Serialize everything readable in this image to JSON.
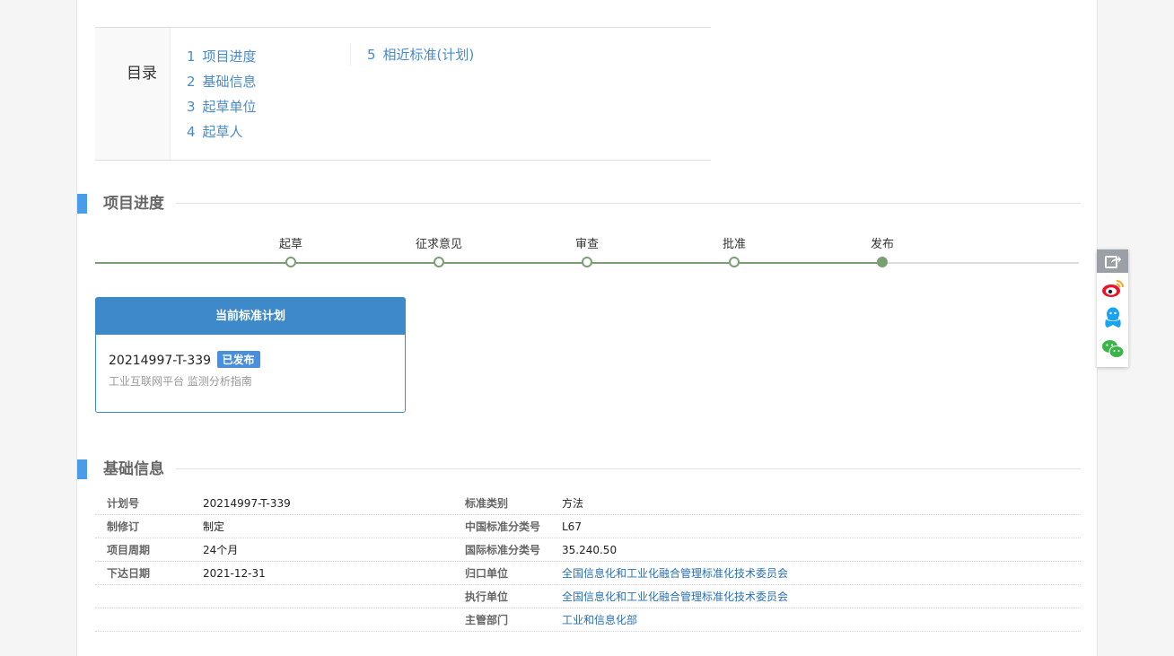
{
  "toc": {
    "title": "目录",
    "items": [
      {
        "num": "1",
        "label": "项目进度"
      },
      {
        "num": "2",
        "label": "基础信息"
      },
      {
        "num": "3",
        "label": "起草单位"
      },
      {
        "num": "4",
        "label": "起草人"
      },
      {
        "num": "5",
        "label": "相近标准(计划)"
      }
    ]
  },
  "progress": {
    "title": "项目进度",
    "steps": [
      "起草",
      "征求意见",
      "审查",
      "批准",
      "发布"
    ],
    "current_step_index": 4,
    "colors": {
      "track_done": "#7a9f72",
      "track_todo": "#dddddd"
    }
  },
  "plan_card": {
    "header": "当前标准计划",
    "code": "20214997-T-339",
    "status_badge": "已发布",
    "name": "工业互联网平台 监测分析指南"
  },
  "basic_info": {
    "title": "基础信息",
    "left": [
      {
        "key": "计划号",
        "value": "20214997-T-339"
      },
      {
        "key": "制修订",
        "value": "制定"
      },
      {
        "key": "项目周期",
        "value": "24个月"
      },
      {
        "key": "下达日期",
        "value": "2021-12-31"
      }
    ],
    "right": [
      {
        "key": "标准类别",
        "value": "方法"
      },
      {
        "key": "中国标准分类号",
        "value": "L67"
      },
      {
        "key": "国际标准分类号",
        "value": "35.240.50"
      },
      {
        "key": "归口单位",
        "value": "全国信息化和工业化融合管理标准化技术委员会"
      },
      {
        "key": "执行单位",
        "value": "全国信息化和工业化融合管理标准化技术委员会"
      },
      {
        "key": "主管部门",
        "value": "工业和信息化部"
      }
    ]
  },
  "share_bar": {
    "icons": [
      "share-icon",
      "weibo-icon",
      "qq-icon",
      "wechat-icon"
    ]
  },
  "colors": {
    "accent": "#4a9be8",
    "card_header": "#3d89c9",
    "link": "#4a8ac8"
  }
}
